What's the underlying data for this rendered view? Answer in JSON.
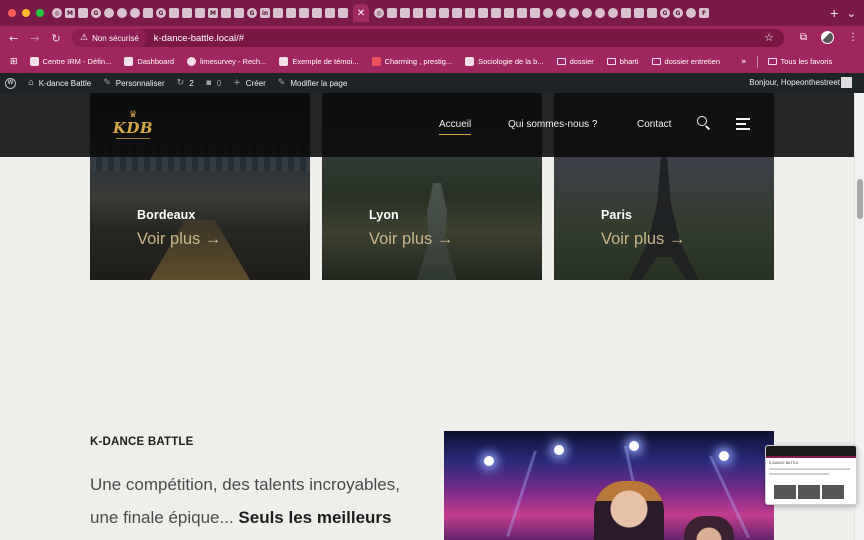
{
  "browser": {
    "security_label": "Non sécurisé",
    "url": "k-dance-battle.local/#",
    "bookmarks": [
      {
        "label": "Centre IRM - Défin..."
      },
      {
        "label": "Dashboard"
      },
      {
        "label": "limesurvey - Rech..."
      },
      {
        "label": "Exemple de témoi..."
      },
      {
        "label": "Charming , prestig..."
      },
      {
        "label": "Sociologie de la b..."
      },
      {
        "label": "dossier"
      },
      {
        "label": "bharti"
      },
      {
        "label": "dossier entretien"
      }
    ],
    "all_bookmarks_label": "Tous les favoris",
    "more_bookmarks": "»"
  },
  "wp_admin_bar": {
    "site_name": "K-dance Battle",
    "customize": "Personnaliser",
    "updates_count": "2",
    "comments_count": "0",
    "new_label": "Créer",
    "edit_label": "Modifier la page",
    "greeting": "Bonjour, Hopeonthestreet"
  },
  "site": {
    "logo_text": "KDB",
    "nav": {
      "home": "Accueil",
      "about": "Qui sommes-nous ?",
      "contact": "Contact"
    },
    "cities": [
      {
        "name": "Bordeaux",
        "cta": "Voir plus →"
      },
      {
        "name": "Lyon",
        "cta": "Voir plus →"
      },
      {
        "name": "Paris",
        "cta": "Voir plus →"
      }
    ],
    "intro": {
      "eyebrow": "K-DANCE BATTLE",
      "text_regular": "Une compétition, des talents incroyables, une finale épique... ",
      "text_bold": "Seuls les meilleurs"
    }
  },
  "colors": {
    "chrome_tabstrip": "#7a1a48",
    "chrome_toolbar": "#a0265f",
    "wp_bar": "#1d2327",
    "accent_gold": "#d7a84a",
    "cta_gold": "#c9b68a",
    "page_bg": "#efeeeb"
  }
}
